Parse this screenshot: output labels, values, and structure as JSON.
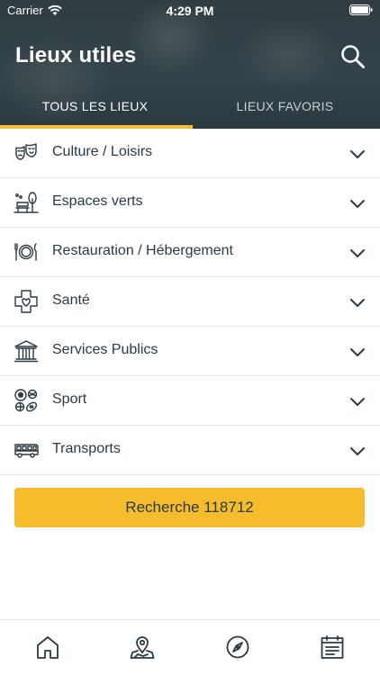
{
  "status_bar": {
    "carrier": "Carrier",
    "time": "4:29 PM"
  },
  "header": {
    "title": "Lieux utiles",
    "tabs": [
      {
        "label": "TOUS LES LIEUX",
        "active": true
      },
      {
        "label": "LIEUX FAVORIS",
        "active": false
      }
    ],
    "search_icon": "search-icon"
  },
  "categories": [
    {
      "label": "Culture / Loisirs",
      "icon": "theater-masks-icon"
    },
    {
      "label": "Espaces verts",
      "icon": "park-bench-icon"
    },
    {
      "label": "Restauration / Hébergement",
      "icon": "plate-cutlery-icon"
    },
    {
      "label": "Santé",
      "icon": "medical-cross-heart-icon"
    },
    {
      "label": "Services Publics",
      "icon": "public-building-icon"
    },
    {
      "label": "Sport",
      "icon": "sport-balls-icon"
    },
    {
      "label": "Transports",
      "icon": "bus-icon"
    }
  ],
  "cta": {
    "label": "Recherche 118712"
  },
  "tabbar": {
    "items": [
      {
        "icon": "home-icon"
      },
      {
        "icon": "map-pin-icon"
      },
      {
        "icon": "compass-icon"
      },
      {
        "icon": "calendar-icon"
      }
    ]
  },
  "colors": {
    "accent": "#f5bd2b",
    "text": "#2b3a44",
    "header_bg": "#33424a"
  }
}
